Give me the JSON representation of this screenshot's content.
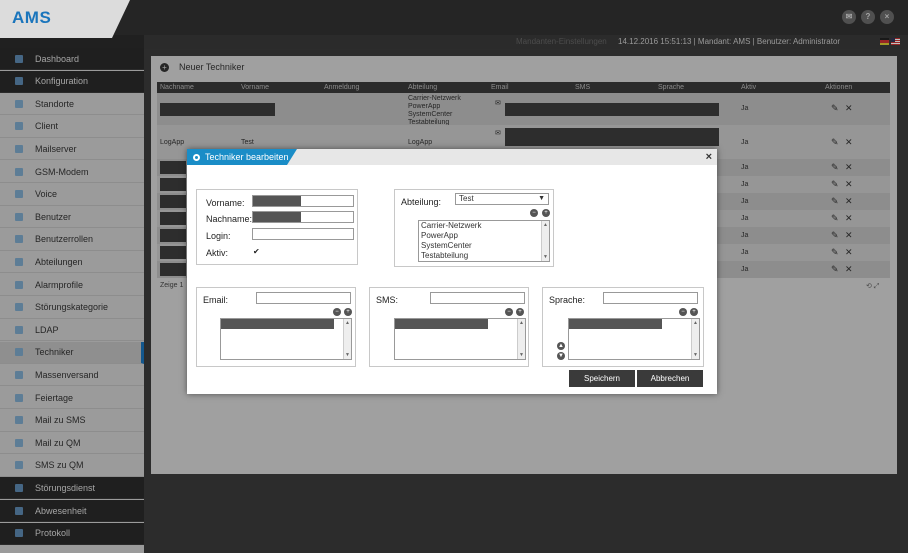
{
  "app": {
    "logo": "AMS"
  },
  "header": {
    "icons": [
      "mail-icon",
      "help-icon",
      "close-icon"
    ],
    "mandant_settings": "Mandanten-Einstellungen",
    "status": "14.12.2016 15:51:13  |  Mandant: AMS  |  Benutzer: Administrator"
  },
  "sidebar": {
    "items": [
      {
        "label": "Dashboard",
        "icon": "dashboard-icon"
      },
      {
        "label": "Konfiguration",
        "icon": "config-icon"
      },
      {
        "label": "Standorte",
        "icon": "location-icon"
      },
      {
        "label": "Client",
        "icon": "client-icon"
      },
      {
        "label": "Mailserver",
        "icon": "mailserver-icon"
      },
      {
        "label": "GSM-Modem",
        "icon": "modem-icon"
      },
      {
        "label": "Voice",
        "icon": "voice-icon"
      },
      {
        "label": "Benutzer",
        "icon": "user-icon"
      },
      {
        "label": "Benutzerrollen",
        "icon": "roles-icon"
      },
      {
        "label": "Abteilungen",
        "icon": "department-icon"
      },
      {
        "label": "Alarmprofile",
        "icon": "alarm-icon"
      },
      {
        "label": "Störungskategorie",
        "icon": "category-icon"
      },
      {
        "label": "LDAP",
        "icon": "ldap-icon"
      },
      {
        "label": "Techniker",
        "icon": "technician-icon"
      },
      {
        "label": "Massenversand",
        "icon": "mass-send-icon"
      },
      {
        "label": "Feiertage",
        "icon": "holiday-icon"
      },
      {
        "label": "Mail zu SMS",
        "icon": "mail-sms-icon"
      },
      {
        "label": "Mail zu QM",
        "icon": "mail-qm-icon"
      },
      {
        "label": "SMS zu QM",
        "icon": "sms-qm-icon"
      },
      {
        "label": "Störungsdienst",
        "icon": "service-icon"
      },
      {
        "label": "Abwesenheit",
        "icon": "absence-icon"
      },
      {
        "label": "Protokoll",
        "icon": "log-icon"
      }
    ]
  },
  "main": {
    "new_label": "Neuer Techniker",
    "table": {
      "headers": [
        "Nachname",
        "Vorname",
        "Anmeldung",
        "Abteilung",
        "Email",
        "SMS",
        "Sprache",
        "Aktiv",
        "Aktionen"
      ],
      "row1_abteilung": [
        "Carrier-Netzwerk",
        "PowerApp",
        "SystemCenter",
        "Testabteilung"
      ],
      "row2": {
        "nachname": "LogApp",
        "vorname": "Test",
        "abteilung": "LogApp"
      },
      "aktiv": "Ja",
      "footer": "Zeige 1"
    }
  },
  "modal": {
    "title": "Techniker bearbeiten",
    "close": "×",
    "vorname_label": "Vorname:",
    "nachname_label": "Nachname:",
    "login_label": "Login:",
    "aktiv_label": "Aktiv:",
    "aktiv_checked": "✔",
    "abteilung_label": "Abteilung:",
    "abteilung_selected": "Test",
    "abteilung_options": [
      "Carrier-Netzwerk",
      "PowerApp",
      "SystemCenter",
      "Testabteilung"
    ],
    "email_label": "Email:",
    "sms_label": "SMS:",
    "sprache_label": "Sprache:",
    "save_label": "Speichern",
    "cancel_label": "Abbrechen"
  }
}
